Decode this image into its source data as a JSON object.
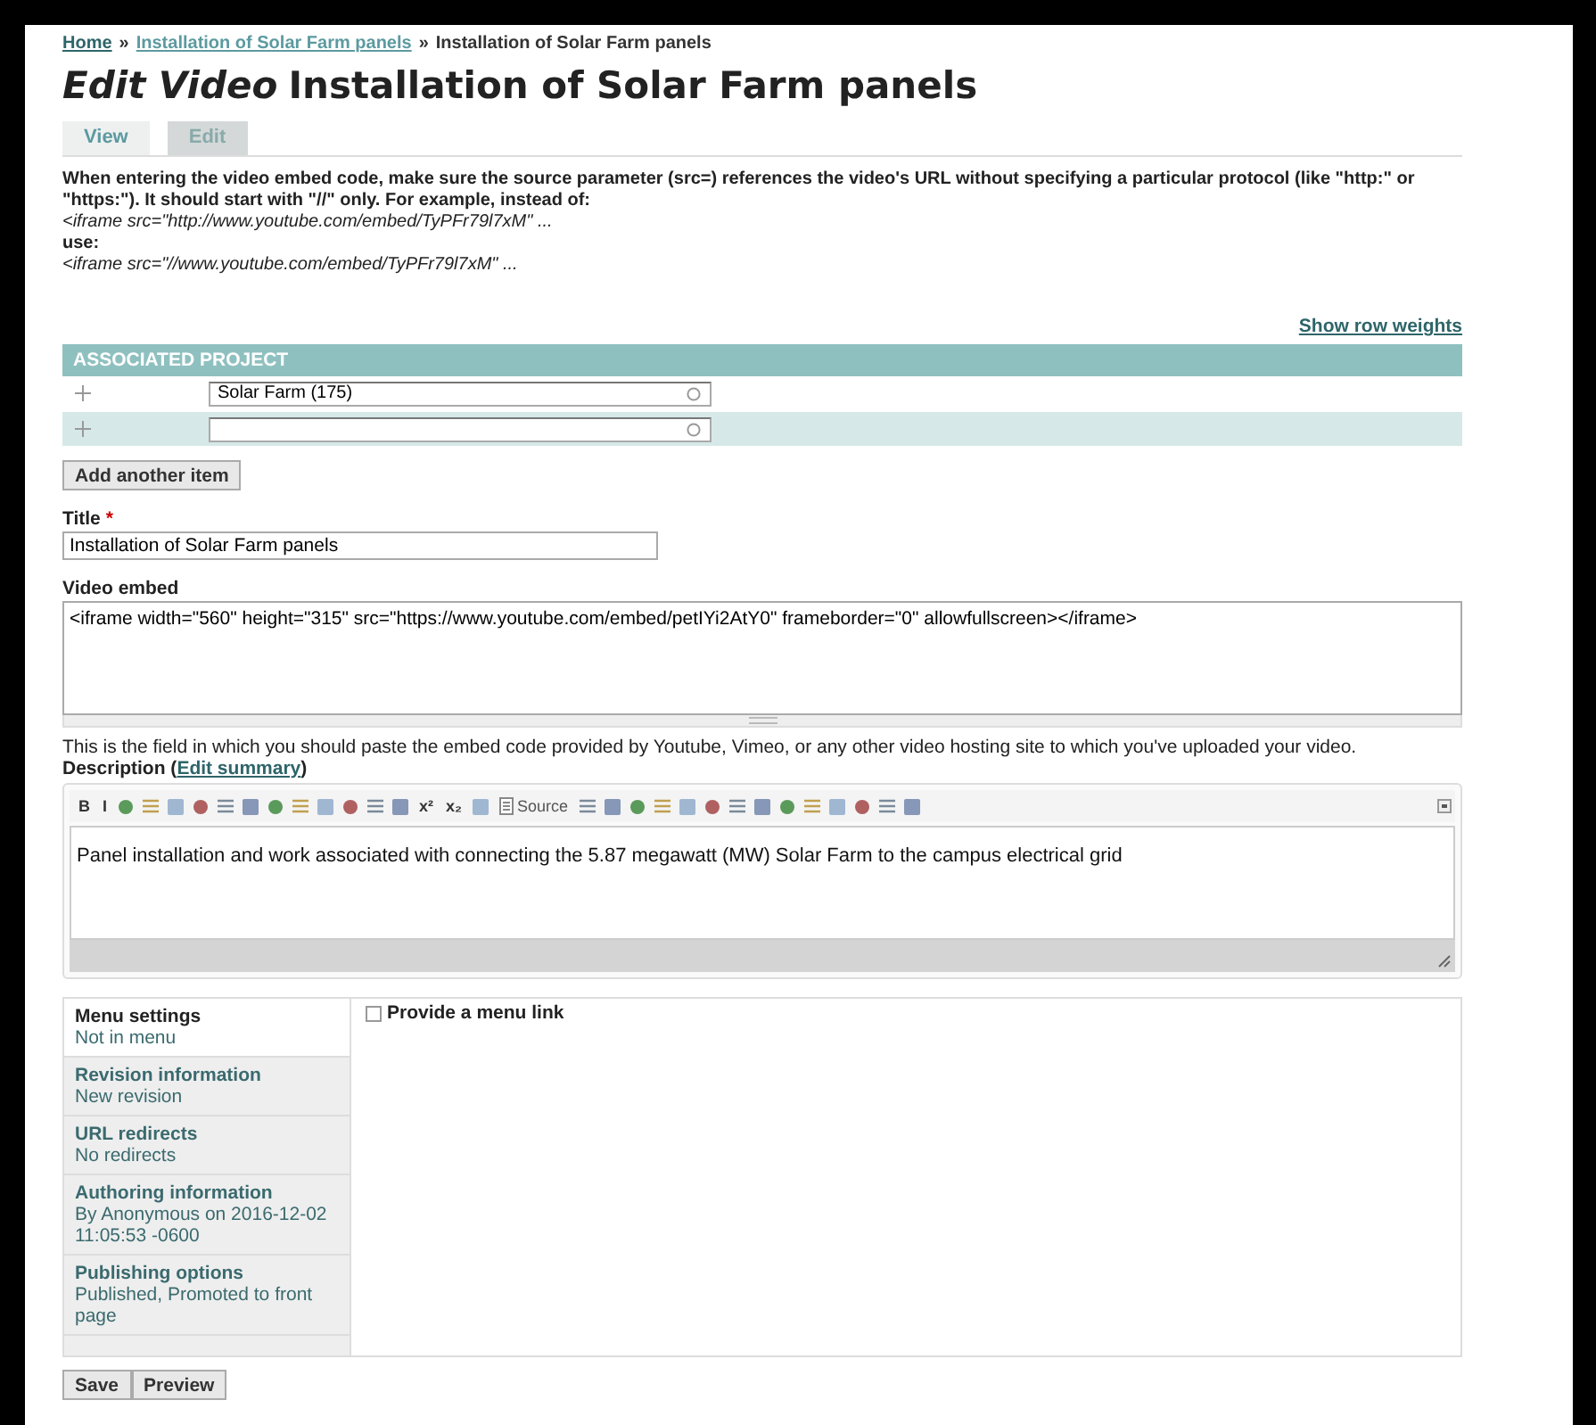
{
  "breadcrumb": [
    {
      "label": "Home",
      "kind": "link"
    },
    {
      "label": "Installation of Solar Farm panels",
      "kind": "link"
    },
    {
      "label": "Installation of Solar Farm panels",
      "kind": "current"
    }
  ],
  "separator": "»",
  "page_title": {
    "prefix": "Edit Video",
    "title": "Installation of Solar Farm panels"
  },
  "tabs": [
    {
      "label": "View",
      "selected": false
    },
    {
      "label": "Edit",
      "selected": true
    }
  ],
  "help_lines": [
    {
      "kind": "plain",
      "text": "When entering the video embed code, make sure the source parameter (src=) references the video's URL without specifying a particular protocol (like \"http:\" or \"https:\"). It should start with \"//\" only. For example, instead of:"
    },
    {
      "kind": "code",
      "text": "<iframe src=\"http://www.youtube.com/embed/TyPFr79l7xM\" ..."
    },
    {
      "kind": "plain",
      "text": "use:"
    },
    {
      "kind": "code",
      "text": "<iframe src=\"//www.youtube.com/embed/TyPFr79l7xM\" ..."
    }
  ],
  "show_row_weights": "Show row weights",
  "associated_project": {
    "heading": "ASSOCIATED PROJECT",
    "rows": [
      {
        "value": "Solar Farm (175)"
      },
      {
        "value": ""
      }
    ],
    "add_button": "Add another item"
  },
  "title_field": {
    "label": "Title",
    "required": true,
    "required_mark": "*",
    "value": "Installation of Solar Farm panels"
  },
  "video_embed": {
    "label": "Video embed",
    "value": "<iframe width=\"560\" height=\"315\" src=\"https://www.youtube.com/embed/petIYi2AtY0\" frameborder=\"0\" allowfullscreen></iframe>",
    "help": "This is the field in which you should paste the embed code provided by Youtube, Vimeo, or any other video hosting site to which you've uploaded your video."
  },
  "description": {
    "label": "Description",
    "paren_open": "(",
    "link": "Edit summary",
    "paren_close": ")",
    "toolbar": [
      {
        "kind": "text",
        "label": "B"
      },
      {
        "kind": "text",
        "label": "I"
      },
      {
        "kind": "icon"
      },
      {
        "kind": "icon"
      },
      {
        "kind": "icon"
      },
      {
        "kind": "icon"
      },
      {
        "kind": "icon"
      },
      {
        "kind": "icon"
      },
      {
        "kind": "icon"
      },
      {
        "kind": "icon"
      },
      {
        "kind": "icon"
      },
      {
        "kind": "icon"
      },
      {
        "kind": "icon"
      },
      {
        "kind": "icon"
      },
      {
        "kind": "text",
        "label": "x²"
      },
      {
        "kind": "text",
        "label": "x₂"
      },
      {
        "kind": "icon"
      },
      {
        "kind": "source",
        "label": "Source"
      },
      {
        "kind": "icon"
      },
      {
        "kind": "icon"
      },
      {
        "kind": "icon"
      },
      {
        "kind": "icon"
      },
      {
        "kind": "icon"
      },
      {
        "kind": "icon"
      },
      {
        "kind": "icon"
      },
      {
        "kind": "icon"
      },
      {
        "kind": "icon"
      },
      {
        "kind": "icon"
      },
      {
        "kind": "icon"
      },
      {
        "kind": "icon"
      },
      {
        "kind": "icon"
      },
      {
        "kind": "icon"
      }
    ],
    "body": "Panel installation and work associated with connecting the 5.87 megawatt (MW) Solar Farm to the campus electrical grid"
  },
  "vertical_tabs": [
    {
      "title": "Menu settings",
      "summary": "Not in menu",
      "selected": true
    },
    {
      "title": "Revision information",
      "summary": "New revision",
      "selected": false
    },
    {
      "title": "URL redirects",
      "summary": "No redirects",
      "selected": false
    },
    {
      "title": "Authoring information",
      "summary": "By Anonymous on 2016-12-02 11:05:53 -0600",
      "selected": false
    },
    {
      "title": "Publishing options",
      "summary": "Published, Promoted to front page",
      "selected": false
    }
  ],
  "menu_link": {
    "label": "Provide a menu link",
    "checked": false
  },
  "buttons": [
    "Save",
    "Preview"
  ]
}
